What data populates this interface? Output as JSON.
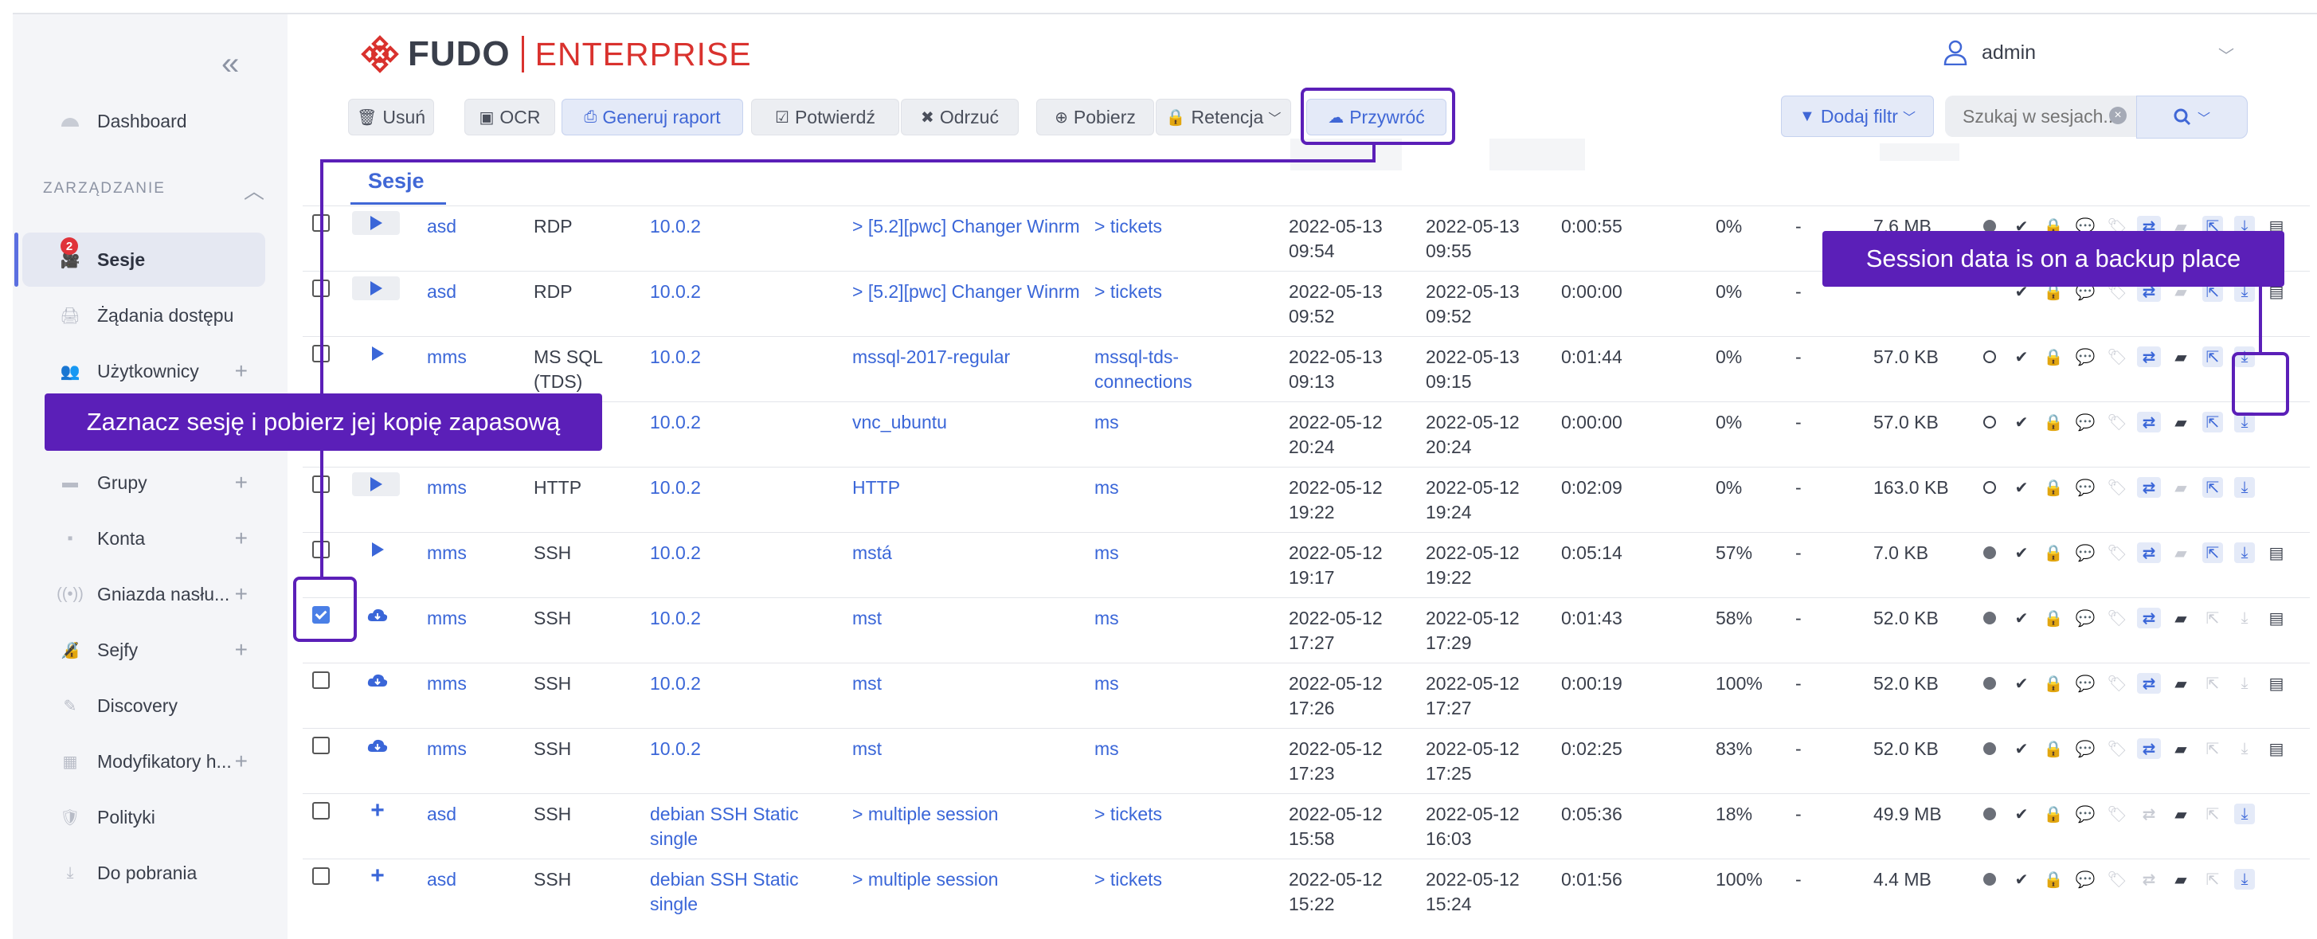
{
  "sidebar": {
    "collapse": "«",
    "dashboard": "Dashboard",
    "section": "ZARZĄDZANIE",
    "items": [
      {
        "label": "Sesje",
        "badge": "2"
      },
      {
        "label": "Żądania dostępu"
      },
      {
        "label": "Użytkownicy",
        "plus": "+"
      },
      {
        "label": "Grupy",
        "plus": "+"
      },
      {
        "label": "Konta",
        "plus": "+"
      },
      {
        "label": "Gniazda nasłu...",
        "plus": "+"
      },
      {
        "label": "Sejfy",
        "plus": "+"
      },
      {
        "label": "Discovery"
      },
      {
        "label": "Modyfikatory h...",
        "plus": "+"
      },
      {
        "label": "Polityki"
      },
      {
        "label": "Do pobrania"
      }
    ]
  },
  "header": {
    "logo_left": "FUDO",
    "logo_right": "ENTERPRISE",
    "user": "admin"
  },
  "toolbar": {
    "delete": "Usuń",
    "ocr": "OCR",
    "report": "Generuj raport",
    "confirm": "Potwierdź",
    "reject": "Odrzuć",
    "download": "Pobierz",
    "retention": "Retencja",
    "restore": "Przywróć",
    "add_filter": "Dodaj filtr",
    "search_placeholder": "Szukaj w sesjach..."
  },
  "table": {
    "tab": "Sesje",
    "rows": [
      {
        "checked": false,
        "icon": "play-box",
        "user": "asd",
        "protocol": "RDP",
        "server": "10.0.2",
        "account": "> [5.2][pwc] Changer Winrm",
        "safe": "> tickets",
        "start": [
          "2022-05-13",
          "09:54"
        ],
        "end": [
          "2022-05-13",
          "09:55"
        ],
        "duration": "0:00:55",
        "progress": "0%",
        "risk": "-",
        "size": "7.6 MB",
        "status": "filled"
      },
      {
        "checked": false,
        "icon": "play-box",
        "user": "asd",
        "protocol": "RDP",
        "server": "10.0.2",
        "account": "> [5.2][pwc] Changer Winrm",
        "safe": "> tickets",
        "start": [
          "2022-05-13",
          "09:52"
        ],
        "end": [
          "2022-05-13",
          "09:52"
        ],
        "duration": "0:00:00",
        "progress": "0%",
        "risk": "-",
        "size": "",
        "status": "filled"
      },
      {
        "checked": false,
        "icon": "play",
        "user": "mms",
        "protocol": [
          "MS SQL",
          "(TDS)"
        ],
        "server": "10.0.2",
        "account": "mssql-2017-regular",
        "safe": [
          "mssql-tds-",
          "connections"
        ],
        "start": [
          "2022-05-13",
          "09:13"
        ],
        "end": [
          "2022-05-13",
          "09:15"
        ],
        "duration": "0:01:44",
        "progress": "0%",
        "risk": "-",
        "size": "57.0 KB",
        "status": "empty"
      },
      {
        "checked": false,
        "icon": "play",
        "user": "",
        "protocol": "",
        "server": "10.0.2",
        "account": "vnc_ubuntu",
        "safe": "ms",
        "start": [
          "2022-05-12",
          "20:24"
        ],
        "end": [
          "2022-05-12",
          "20:24"
        ],
        "duration": "0:00:00",
        "progress": "0%",
        "risk": "-",
        "size": "57.0 KB",
        "status": "empty"
      },
      {
        "checked": false,
        "icon": "play-box",
        "user": "mms",
        "protocol": "HTTP",
        "server": "10.0.2",
        "account": "HTTP",
        "safe": "ms",
        "start": [
          "2022-05-12",
          "19:22"
        ],
        "end": [
          "2022-05-12",
          "19:24"
        ],
        "duration": "0:02:09",
        "progress": "0%",
        "risk": "-",
        "size": "163.0 KB",
        "status": "empty"
      },
      {
        "checked": false,
        "icon": "play",
        "user": "mms",
        "protocol": "SSH",
        "server": "10.0.2",
        "account": "mstá",
        "safe": "ms",
        "start": [
          "2022-05-12",
          "19:17"
        ],
        "end": [
          "2022-05-12",
          "19:22"
        ],
        "duration": "0:05:14",
        "progress": "57%",
        "risk": "-",
        "size": "7.0 KB",
        "status": "filled"
      },
      {
        "checked": true,
        "icon": "cloud",
        "user": "mms",
        "protocol": "SSH",
        "server": "10.0.2",
        "account": "mst",
        "safe": "ms",
        "start": [
          "2022-05-12",
          "17:27"
        ],
        "end": [
          "2022-05-12",
          "17:29"
        ],
        "duration": "0:01:43",
        "progress": "58%",
        "risk": "-",
        "size": "52.0 KB",
        "status": "filled"
      },
      {
        "checked": false,
        "icon": "cloud",
        "user": "mms",
        "protocol": "SSH",
        "server": "10.0.2",
        "account": "mst",
        "safe": "ms",
        "start": [
          "2022-05-12",
          "17:26"
        ],
        "end": [
          "2022-05-12",
          "17:27"
        ],
        "duration": "0:00:19",
        "progress": "100%",
        "risk": "-",
        "size": "52.0 KB",
        "status": "filled"
      },
      {
        "checked": false,
        "icon": "cloud",
        "user": "mms",
        "protocol": "SSH",
        "server": "10.0.2",
        "account": "mst",
        "safe": "ms",
        "start": [
          "2022-05-12",
          "17:23"
        ],
        "end": [
          "2022-05-12",
          "17:25"
        ],
        "duration": "0:02:25",
        "progress": "83%",
        "risk": "-",
        "size": "52.0 KB",
        "status": "filled"
      },
      {
        "checked": false,
        "icon": "plus",
        "user": "asd",
        "protocol": "SSH",
        "server": [
          "debian SSH Static",
          "single"
        ],
        "account": "> multiple session",
        "safe": "> tickets",
        "start": [
          "2022-05-12",
          "15:58"
        ],
        "end": [
          "2022-05-12",
          "16:03"
        ],
        "duration": "0:05:36",
        "progress": "18%",
        "risk": "-",
        "size": "49.9 MB",
        "status": "filled"
      },
      {
        "checked": false,
        "icon": "plus",
        "user": "asd",
        "protocol": "SSH",
        "server": [
          "debian SSH Static",
          "single"
        ],
        "account": "> multiple session",
        "safe": "> tickets",
        "start": [
          "2022-05-12",
          "15:22"
        ],
        "end": [
          "2022-05-12",
          "15:24"
        ],
        "duration": "0:01:56",
        "progress": "100%",
        "risk": "-",
        "size": "4.4 MB",
        "status": "filled"
      }
    ]
  },
  "annotations": {
    "left": "Zaznacz sesję i pobierz jej kopię zapasową",
    "right": "Session data is on a backup place"
  },
  "colors": {
    "accent": "#4067d6",
    "brand": "#d9322e",
    "annotation": "#5b1fb8"
  }
}
